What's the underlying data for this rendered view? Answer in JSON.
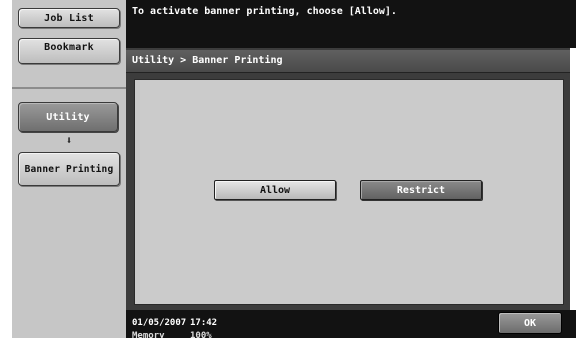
{
  "sidebar": {
    "job_list_label": "Job List",
    "bookmark_label": "Bookmark",
    "utility_label": "Utility",
    "nav_arrow_icon": "down-arrow-icon",
    "banner_printing_label": "Banner Printing"
  },
  "message": {
    "text": "To activate banner printing, choose [Allow]."
  },
  "main": {
    "breadcrumb": "Utility > Banner Printing",
    "allow_label": "Allow",
    "restrict_label": "Restrict",
    "selected_option": "Restrict"
  },
  "status": {
    "date": "01/05/2007",
    "time": "17:42",
    "memory_label": "Memory",
    "memory_value": "100%",
    "ok_label": "OK"
  },
  "colors": {
    "panel_bg": "#c6c6c6",
    "bar_bg": "#121212",
    "selected_button": "#6f6f6f",
    "unselected_button": "#d0d0d0"
  }
}
